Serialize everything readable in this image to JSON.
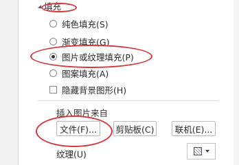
{
  "fill_section": {
    "title": "填充",
    "options": [
      {
        "label": "纯色填充(S)",
        "type": "radio",
        "checked": false
      },
      {
        "label": "渐变填充(G)",
        "type": "radio",
        "checked": false
      },
      {
        "label": "图片或纹理填充(P)",
        "type": "radio",
        "checked": true
      },
      {
        "label": "图案填充(A)",
        "type": "radio",
        "checked": false
      },
      {
        "label": "隐藏背景图形(H)",
        "type": "checkbox",
        "checked": false
      }
    ]
  },
  "insert_picture": {
    "heading": "插入图片来自",
    "buttons": {
      "file": "文件(F)...",
      "clipboard": "剪贴板(C)",
      "online": "联机(E)..."
    }
  },
  "texture": {
    "label": "纹理(U)",
    "dropdown_icon": "texture-pattern-icon"
  },
  "colors": {
    "annotation": "#d9363a",
    "panel_bg": "#ffffff",
    "strip_bg": "#f1f1f1"
  }
}
